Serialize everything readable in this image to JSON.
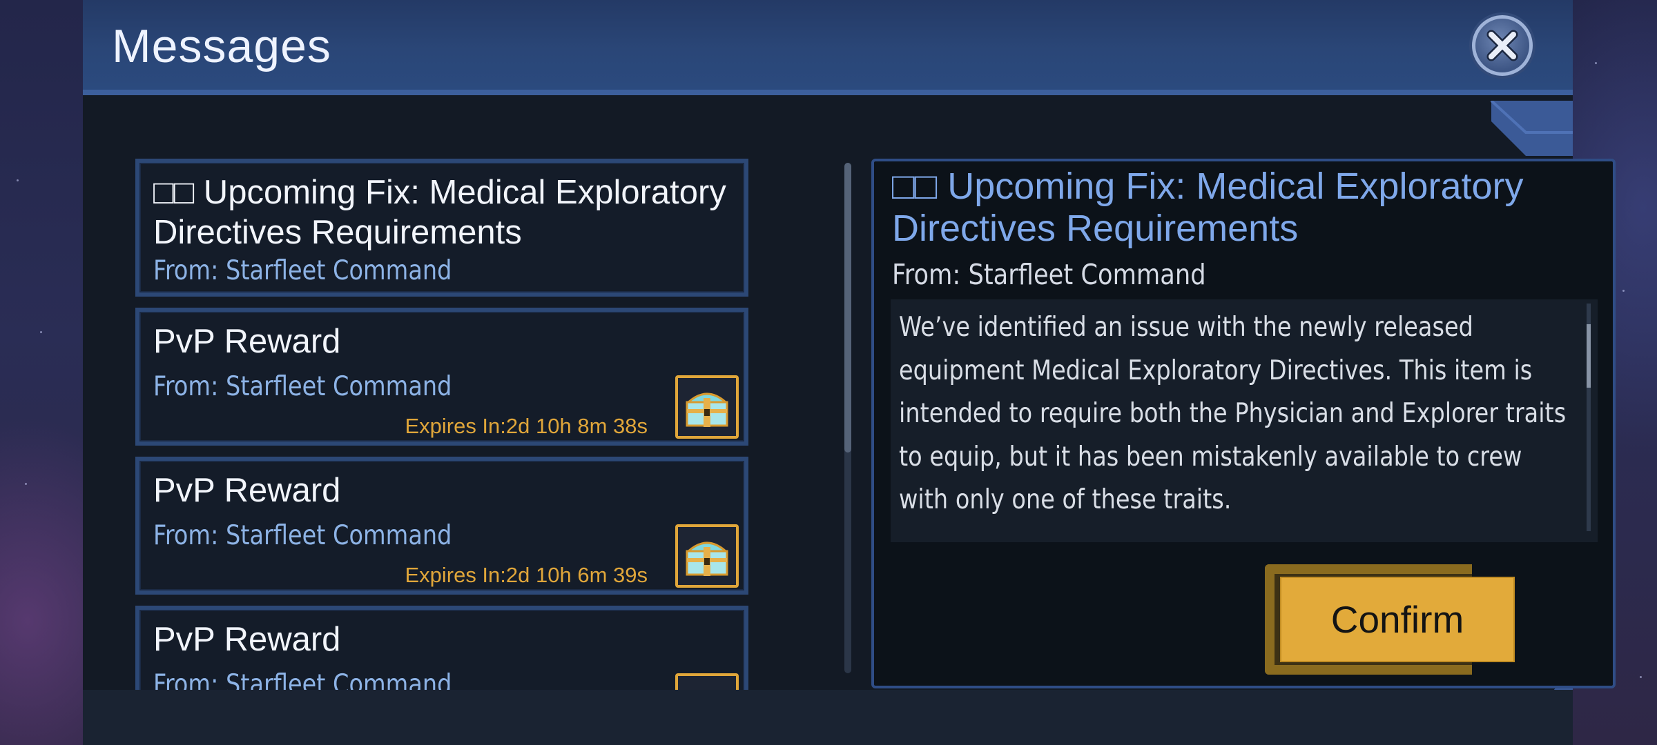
{
  "window": {
    "title": "Messages"
  },
  "messages": [
    {
      "title": "□□ Upcoming Fix: Medical Exploratory Directives Requirements",
      "from": "From: Starfleet Command",
      "expires": "",
      "has_reward": false
    },
    {
      "title": "PvP Reward",
      "from": "From: Starfleet Command",
      "expires": "Expires In:2d 10h 8m 38s",
      "has_reward": true
    },
    {
      "title": "PvP Reward",
      "from": "From: Starfleet Command",
      "expires": "Expires In:2d 10h 6m 39s",
      "has_reward": true
    },
    {
      "title": "PvP Reward",
      "from": "From: Starfleet Command",
      "expires": "",
      "has_reward": true
    }
  ],
  "detail": {
    "title": "□□ Upcoming Fix: Medical Exploratory Directives Requirements",
    "from": "From: Starfleet Command",
    "body": "We’ve identified an issue with the newly released equipment Medical Exploratory Directives. This item is intended to require both the Physician and Explorer traits to equip, but it has been mistakenly available to crew with only one of these traits.",
    "confirm_label": "Confirm"
  },
  "icons": {
    "close": "close-icon",
    "reward": "treasure-chest-icon"
  },
  "colors": {
    "accent_gold": "#e2aa3a",
    "title_blue": "#7fa8ea",
    "from_blue": "#8db3e6",
    "expires_gold": "#e0a63a"
  }
}
